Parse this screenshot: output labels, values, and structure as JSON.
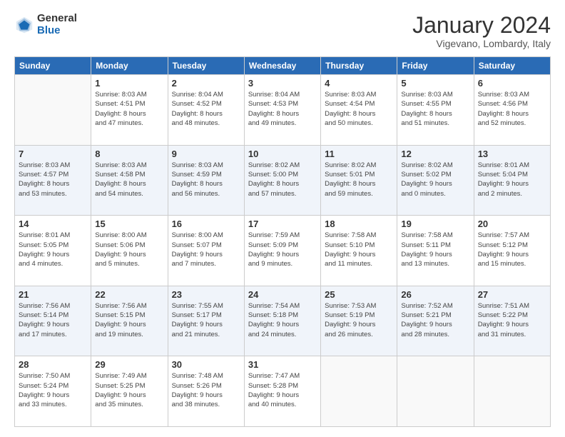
{
  "logo": {
    "general": "General",
    "blue": "Blue"
  },
  "header": {
    "month": "January 2024",
    "location": "Vigevano, Lombardy, Italy"
  },
  "weekdays": [
    "Sunday",
    "Monday",
    "Tuesday",
    "Wednesday",
    "Thursday",
    "Friday",
    "Saturday"
  ],
  "weeks": [
    [
      {
        "day": "",
        "info": ""
      },
      {
        "day": "1",
        "info": "Sunrise: 8:03 AM\nSunset: 4:51 PM\nDaylight: 8 hours\nand 47 minutes."
      },
      {
        "day": "2",
        "info": "Sunrise: 8:04 AM\nSunset: 4:52 PM\nDaylight: 8 hours\nand 48 minutes."
      },
      {
        "day": "3",
        "info": "Sunrise: 8:04 AM\nSunset: 4:53 PM\nDaylight: 8 hours\nand 49 minutes."
      },
      {
        "day": "4",
        "info": "Sunrise: 8:03 AM\nSunset: 4:54 PM\nDaylight: 8 hours\nand 50 minutes."
      },
      {
        "day": "5",
        "info": "Sunrise: 8:03 AM\nSunset: 4:55 PM\nDaylight: 8 hours\nand 51 minutes."
      },
      {
        "day": "6",
        "info": "Sunrise: 8:03 AM\nSunset: 4:56 PM\nDaylight: 8 hours\nand 52 minutes."
      }
    ],
    [
      {
        "day": "7",
        "info": "Sunrise: 8:03 AM\nSunset: 4:57 PM\nDaylight: 8 hours\nand 53 minutes."
      },
      {
        "day": "8",
        "info": "Sunrise: 8:03 AM\nSunset: 4:58 PM\nDaylight: 8 hours\nand 54 minutes."
      },
      {
        "day": "9",
        "info": "Sunrise: 8:03 AM\nSunset: 4:59 PM\nDaylight: 8 hours\nand 56 minutes."
      },
      {
        "day": "10",
        "info": "Sunrise: 8:02 AM\nSunset: 5:00 PM\nDaylight: 8 hours\nand 57 minutes."
      },
      {
        "day": "11",
        "info": "Sunrise: 8:02 AM\nSunset: 5:01 PM\nDaylight: 8 hours\nand 59 minutes."
      },
      {
        "day": "12",
        "info": "Sunrise: 8:02 AM\nSunset: 5:02 PM\nDaylight: 9 hours\nand 0 minutes."
      },
      {
        "day": "13",
        "info": "Sunrise: 8:01 AM\nSunset: 5:04 PM\nDaylight: 9 hours\nand 2 minutes."
      }
    ],
    [
      {
        "day": "14",
        "info": "Sunrise: 8:01 AM\nSunset: 5:05 PM\nDaylight: 9 hours\nand 4 minutes."
      },
      {
        "day": "15",
        "info": "Sunrise: 8:00 AM\nSunset: 5:06 PM\nDaylight: 9 hours\nand 5 minutes."
      },
      {
        "day": "16",
        "info": "Sunrise: 8:00 AM\nSunset: 5:07 PM\nDaylight: 9 hours\nand 7 minutes."
      },
      {
        "day": "17",
        "info": "Sunrise: 7:59 AM\nSunset: 5:09 PM\nDaylight: 9 hours\nand 9 minutes."
      },
      {
        "day": "18",
        "info": "Sunrise: 7:58 AM\nSunset: 5:10 PM\nDaylight: 9 hours\nand 11 minutes."
      },
      {
        "day": "19",
        "info": "Sunrise: 7:58 AM\nSunset: 5:11 PM\nDaylight: 9 hours\nand 13 minutes."
      },
      {
        "day": "20",
        "info": "Sunrise: 7:57 AM\nSunset: 5:12 PM\nDaylight: 9 hours\nand 15 minutes."
      }
    ],
    [
      {
        "day": "21",
        "info": "Sunrise: 7:56 AM\nSunset: 5:14 PM\nDaylight: 9 hours\nand 17 minutes."
      },
      {
        "day": "22",
        "info": "Sunrise: 7:56 AM\nSunset: 5:15 PM\nDaylight: 9 hours\nand 19 minutes."
      },
      {
        "day": "23",
        "info": "Sunrise: 7:55 AM\nSunset: 5:17 PM\nDaylight: 9 hours\nand 21 minutes."
      },
      {
        "day": "24",
        "info": "Sunrise: 7:54 AM\nSunset: 5:18 PM\nDaylight: 9 hours\nand 24 minutes."
      },
      {
        "day": "25",
        "info": "Sunrise: 7:53 AM\nSunset: 5:19 PM\nDaylight: 9 hours\nand 26 minutes."
      },
      {
        "day": "26",
        "info": "Sunrise: 7:52 AM\nSunset: 5:21 PM\nDaylight: 9 hours\nand 28 minutes."
      },
      {
        "day": "27",
        "info": "Sunrise: 7:51 AM\nSunset: 5:22 PM\nDaylight: 9 hours\nand 31 minutes."
      }
    ],
    [
      {
        "day": "28",
        "info": "Sunrise: 7:50 AM\nSunset: 5:24 PM\nDaylight: 9 hours\nand 33 minutes."
      },
      {
        "day": "29",
        "info": "Sunrise: 7:49 AM\nSunset: 5:25 PM\nDaylight: 9 hours\nand 35 minutes."
      },
      {
        "day": "30",
        "info": "Sunrise: 7:48 AM\nSunset: 5:26 PM\nDaylight: 9 hours\nand 38 minutes."
      },
      {
        "day": "31",
        "info": "Sunrise: 7:47 AM\nSunset: 5:28 PM\nDaylight: 9 hours\nand 40 minutes."
      },
      {
        "day": "",
        "info": ""
      },
      {
        "day": "",
        "info": ""
      },
      {
        "day": "",
        "info": ""
      }
    ]
  ]
}
